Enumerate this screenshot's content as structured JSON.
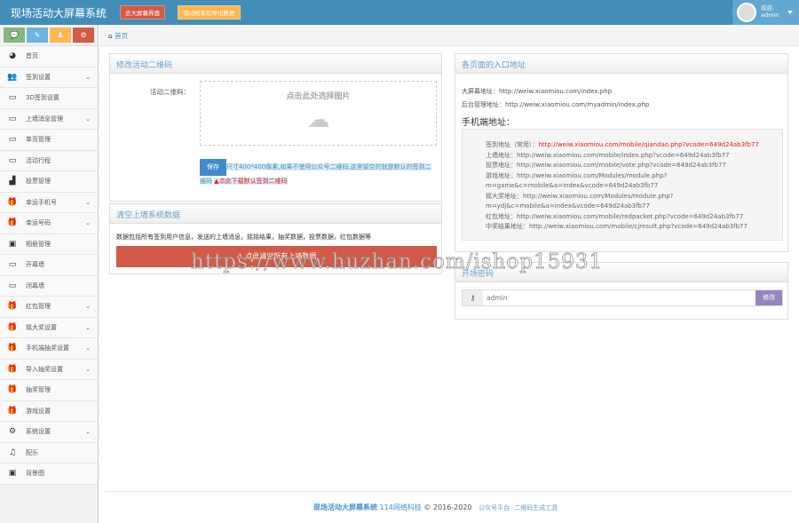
{
  "header": {
    "title": "现场活动大屏幕系统",
    "btn_screen": "去大屏幕界面",
    "btn_export": "活动结束后导出数据",
    "user_greeting": "欢迎,",
    "user_name": "admin"
  },
  "breadcrumb": {
    "home": "首页"
  },
  "sidebar": {
    "items": [
      {
        "label": "首页",
        "icon": "dashboard-icon",
        "sub": false
      },
      {
        "label": "签到设置",
        "icon": "users-icon",
        "sub": true
      },
      {
        "label": "3D签到设置",
        "icon": "desktop-icon",
        "sub": false
      },
      {
        "label": "上墙消息管理",
        "icon": "desktop-icon",
        "sub": true
      },
      {
        "label": "单页管理",
        "icon": "desktop-icon",
        "sub": false
      },
      {
        "label": "活动行程",
        "icon": "desktop-icon",
        "sub": false
      },
      {
        "label": "投票管理",
        "icon": "signal-icon",
        "sub": false
      },
      {
        "label": "幸运手机号",
        "icon": "gift-icon",
        "sub": true
      },
      {
        "label": "幸运号码",
        "icon": "gift-icon",
        "sub": true
      },
      {
        "label": "相册管理",
        "icon": "picture-icon",
        "sub": false
      },
      {
        "label": "开幕墙",
        "icon": "desktop-icon",
        "sub": false
      },
      {
        "label": "闭幕墙",
        "icon": "desktop-icon",
        "sub": false
      },
      {
        "label": "红包管理",
        "icon": "gift-icon",
        "sub": true
      },
      {
        "label": "摇大奖设置",
        "icon": "gift-icon",
        "sub": true
      },
      {
        "label": "手机端抽奖设置",
        "icon": "gift-icon",
        "sub": true
      },
      {
        "label": "导入抽奖设置",
        "icon": "gift-icon",
        "sub": true
      },
      {
        "label": "抽奖管理",
        "icon": "gift-icon",
        "sub": false
      },
      {
        "label": "游戏设置",
        "icon": "gift-icon",
        "sub": false
      },
      {
        "label": "系统设置",
        "icon": "gear-icon",
        "sub": true
      },
      {
        "label": "配乐",
        "icon": "music-icon",
        "sub": false
      },
      {
        "label": "背景图",
        "icon": "picture-icon",
        "sub": false
      }
    ]
  },
  "qr_panel": {
    "title": "修改活动二维码",
    "field_label": "活动二维码：",
    "upload_hint": "点击此处选择图片",
    "save": "保存",
    "note": "尺寸400*400像素,如果不使用公众号二维码,这里留空的就是默认的签到二维码",
    "download_link": "点此下载默认签到二维码"
  },
  "clear_panel": {
    "title": "清空上墙系统数据",
    "desc": "数据包括所有签到用户信息，发送的上墙消息，摇摇结果，抽奖数据，投票数据，红包数据等",
    "button": "点此清空所有上墙数据"
  },
  "entry_panel": {
    "title": "各页面的入口地址",
    "screen": "大屏幕地址：http://weiw.xiaomiou.com/index.php",
    "admin": "后台管理地址：http://weiw.xiaomiou.com/myadmin/index.php",
    "mobile_title": "手机端地址：",
    "checkin_label": "签到地址（常用）：",
    "checkin_url": "http://weiw.xiaomiou.com/mobile/qiandao.php?vcode=649d24ab3fb77",
    "links": [
      "上墙地址：http://weiw.xiaomiou.com/mobile/index.php?vcode=649d24ab3fb77",
      "投票地址：http://weiw.xiaomiou.com/mobile/vote.php?vcode=649d24ab3fb77",
      "游戏地址：http://weiw.xiaomiou.com/Modules/module.php?",
      "m=game&c=mobile&a=index&vcode=649d24ab3fb77",
      "摇大奖地址：http://weiw.xiaomiou.com/Modules/module.php?",
      "m=ydj&c=mobile&a=index&vcode=649d24ab3fb77",
      "红包地址：http://weiw.xiaomiou.com/mobile/redpacket.php?vcode=649d24ab3fb77",
      "中奖结果地址：http://weiw.xiaomiou.com/mobile/cjresult.php?vcode=649d24ab3fb77"
    ]
  },
  "password_panel": {
    "title": "开场密码",
    "value": "admin",
    "button": "修改"
  },
  "footer": {
    "brand": "现场活动大屏幕系统",
    "company": "114网络科技",
    "copyright": "© 2016-2020",
    "link1": "公众号平台",
    "link2": "二维码生成工具"
  },
  "watermark": "https://www.huzhan.com/ishop15931"
}
